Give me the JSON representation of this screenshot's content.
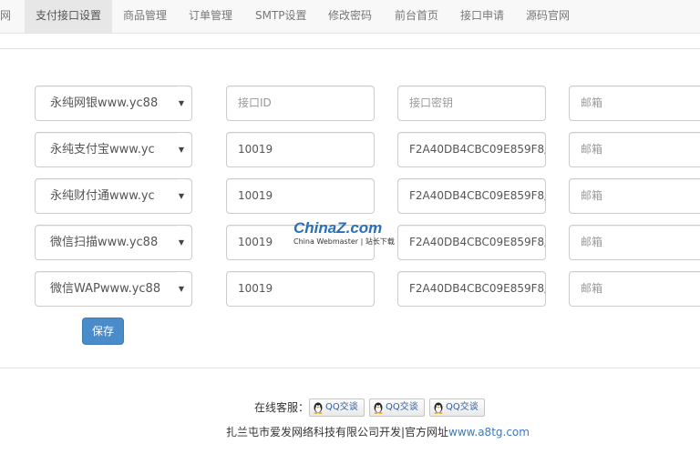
{
  "nav": {
    "items": [
      {
        "label": "网"
      },
      {
        "label": "支付接口设置"
      },
      {
        "label": "商品管理"
      },
      {
        "label": "订单管理"
      },
      {
        "label": "SMTP设置"
      },
      {
        "label": "修改密码"
      },
      {
        "label": "前台首页"
      },
      {
        "label": "接口申请"
      },
      {
        "label": "源码官网"
      }
    ],
    "active_index": 1
  },
  "form": {
    "rows": [
      {
        "channel": "永纯网银www.yc88",
        "id": "",
        "key": "",
        "email": ""
      },
      {
        "channel": "永纯支付宝www.yc",
        "id": "10019",
        "key": "F2A40DB4CBC09E859F8/",
        "email": ""
      },
      {
        "channel": "永纯财付通www.yc",
        "id": "10019",
        "key": "F2A40DB4CBC09E859F8/",
        "email": ""
      },
      {
        "channel": "微信扫描www.yc88",
        "id": "10019",
        "key": "F2A40DB4CBC09E859F8/",
        "email": ""
      },
      {
        "channel": "微信WAPwww.yc88",
        "id": "10019",
        "key": "F2A40DB4CBC09E859F8/",
        "email": ""
      }
    ],
    "placeholders": {
      "id": "接口ID",
      "key": "接口密钥",
      "email": "邮箱"
    },
    "save_label": "保存"
  },
  "watermark": {
    "logo": "ChinaZ.com",
    "sub": "China Webmaster | 站长下载"
  },
  "footer": {
    "service_label": "在线客服：",
    "qq_buttons": [
      "QQ交谈",
      "QQ交谈",
      "QQ交谈"
    ],
    "copyright_text": "扎兰屯市爱发网络科技有限公司开发|官方网址",
    "copyright_link": "www.a8tg.com"
  },
  "colors": {
    "accent": "#4a8cc9",
    "link": "#3b7bbf"
  }
}
